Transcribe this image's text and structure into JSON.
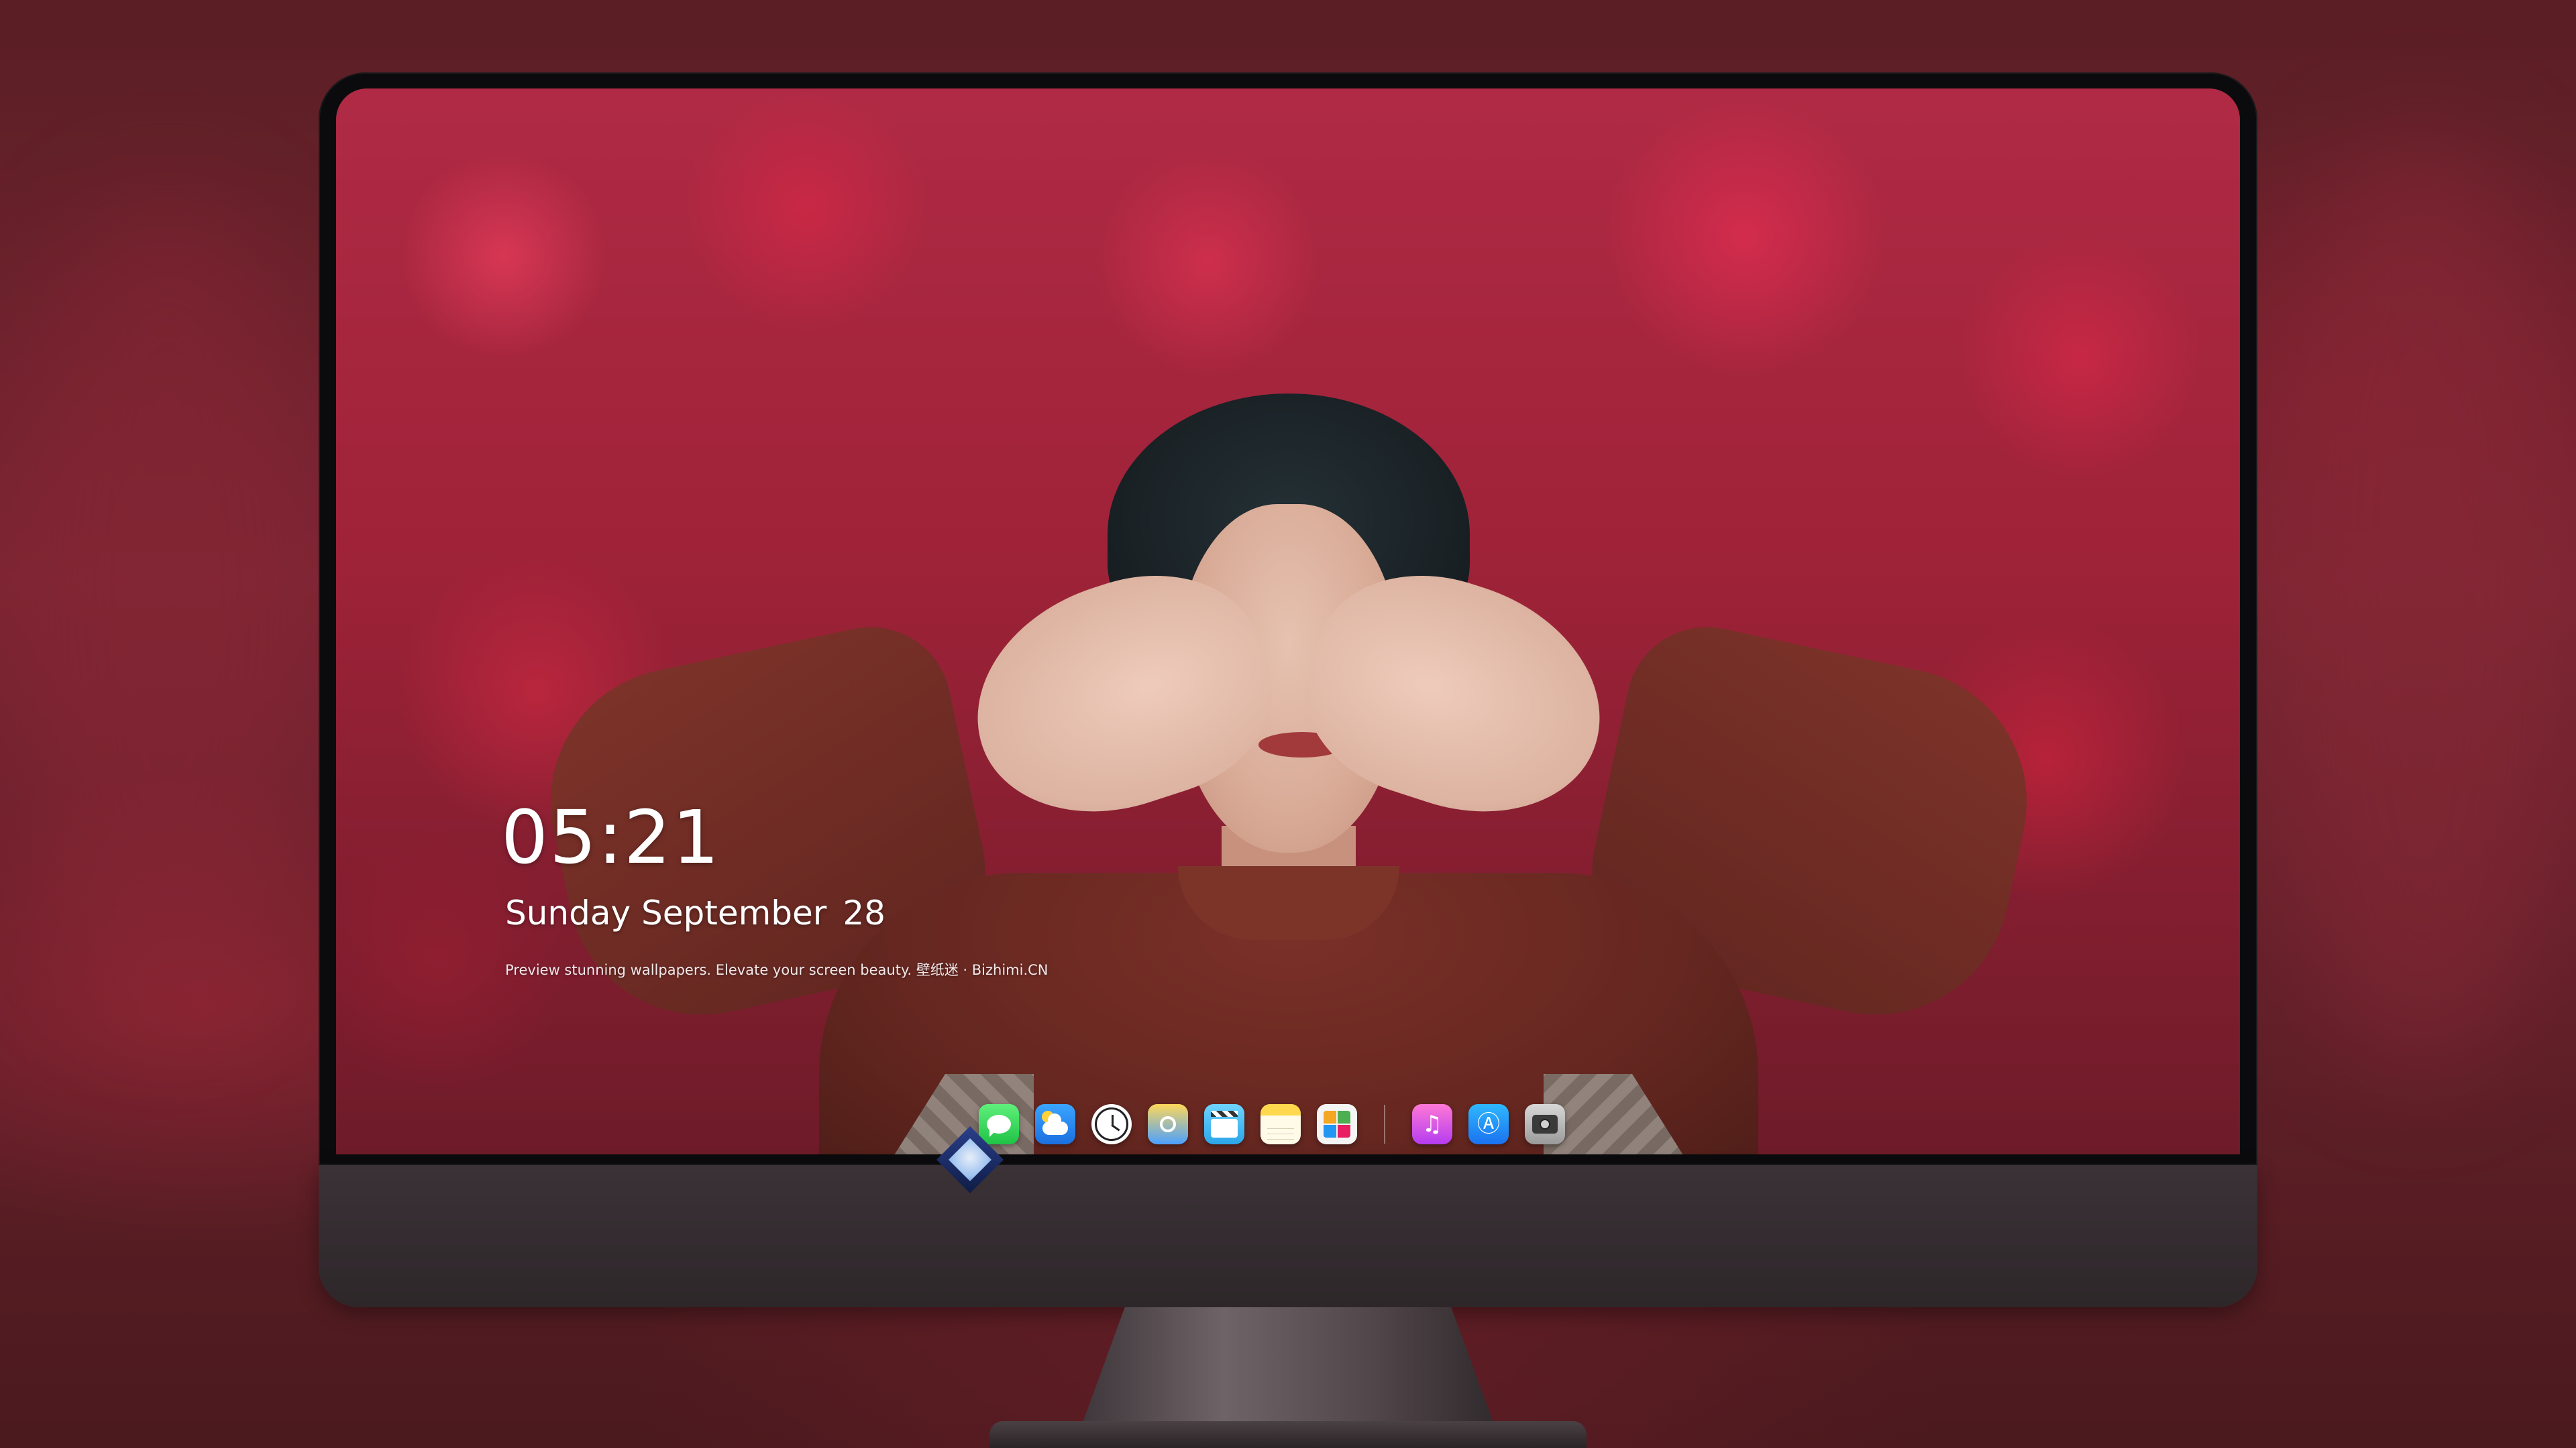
{
  "lock_screen": {
    "time": "05:21",
    "weekday": "Sunday",
    "month": "September",
    "day": "28",
    "tagline": "Preview stunning wallpapers. Elevate your screen beauty. 壁纸迷 · Bizhimi.CN"
  },
  "dock": {
    "apps": [
      {
        "name": "Messages",
        "icon": "messages-icon"
      },
      {
        "name": "Weather",
        "icon": "weather-icon"
      },
      {
        "name": "Clock",
        "icon": "clock-icon"
      },
      {
        "name": "Preview",
        "icon": "preview-icon"
      },
      {
        "name": "Movie",
        "icon": "movie-clapper-icon"
      },
      {
        "name": "Notes",
        "icon": "notes-icon"
      },
      {
        "name": "Photos",
        "icon": "photos-icon"
      }
    ],
    "pinned": [
      {
        "name": "Music",
        "icon": "music-icon"
      },
      {
        "name": "App Store",
        "icon": "app-store-icon"
      },
      {
        "name": "Camera",
        "icon": "camera-icon"
      }
    ]
  },
  "colors": {
    "wallpaper_primary": "#b02a45",
    "sweater": "#652720",
    "monitor_chin": "#3a3236",
    "text": "#ffffff"
  }
}
